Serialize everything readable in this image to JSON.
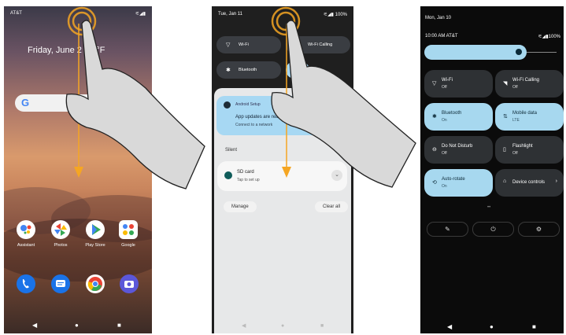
{
  "phone1": {
    "status": {
      "carrier": "AT&T",
      "icons": "⚟◢▮"
    },
    "date_weather": "Friday, June 2   70 °F",
    "search_icon": "G",
    "apps": [
      {
        "label": "Assistant"
      },
      {
        "label": "Photos"
      },
      {
        "label": "Play Store"
      },
      {
        "label": "Google"
      }
    ],
    "dock": [
      "phone-icon",
      "messages-icon",
      "chrome-icon",
      "camera-icon"
    ],
    "nav": {
      "back": "◀",
      "home": "●",
      "recents": "■"
    }
  },
  "phone2": {
    "status": {
      "date": "Tue, Jan 11",
      "icons": "⚟◢▮ 100%"
    },
    "tiles": [
      {
        "label": "Wi-Fi",
        "icon": "wifi-icon"
      },
      {
        "label": "Wi-Fi Calling",
        "icon": "wifi-calling-icon"
      },
      {
        "label": "Bluetooth",
        "icon": "bluetooth-icon"
      }
    ],
    "alert": {
      "app": "Android Setup",
      "title": "App updates are ready",
      "subtitle": "Connect to a network"
    },
    "section_label": "Silent",
    "notification": {
      "title": "SD card",
      "subtitle": "Tap to set up"
    },
    "buttons": {
      "manage": "Manage",
      "clear": "Clear all"
    },
    "nav": {
      "back": "◀",
      "home": "●",
      "recents": "■"
    }
  },
  "phone3": {
    "date": "Mon, Jan 10",
    "time_carrier": "10:00 AM  AT&T",
    "status_icons": "⚟◢▮100%",
    "tiles": [
      {
        "title": "Wi-Fi",
        "sub": "Off",
        "state": "off",
        "icon": "▽"
      },
      {
        "title": "Wi-Fi Calling",
        "sub": "Off",
        "state": "off",
        "icon": "◥"
      },
      {
        "title": "Bluetooth",
        "sub": "On",
        "state": "on",
        "icon": "✱"
      },
      {
        "title": "Mobile data",
        "sub": "LTE",
        "state": "on",
        "icon": "⇅"
      },
      {
        "title": "Do Not Disturb",
        "sub": "Off",
        "state": "off",
        "icon": "⊖"
      },
      {
        "title": "Flashlight",
        "sub": "Off",
        "state": "off",
        "icon": "▯"
      },
      {
        "title": "Auto-rotate",
        "sub": "On",
        "state": "on",
        "icon": "⟲"
      },
      {
        "title": "Device controls",
        "sub": "",
        "state": "off",
        "icon": "⌂"
      }
    ],
    "page_dots": "••",
    "bottom_buttons": {
      "edit": "✎",
      "power": "⏻",
      "settings": "⚙"
    },
    "nav": {
      "back": "◀",
      "home": "●",
      "recents": "■"
    }
  }
}
